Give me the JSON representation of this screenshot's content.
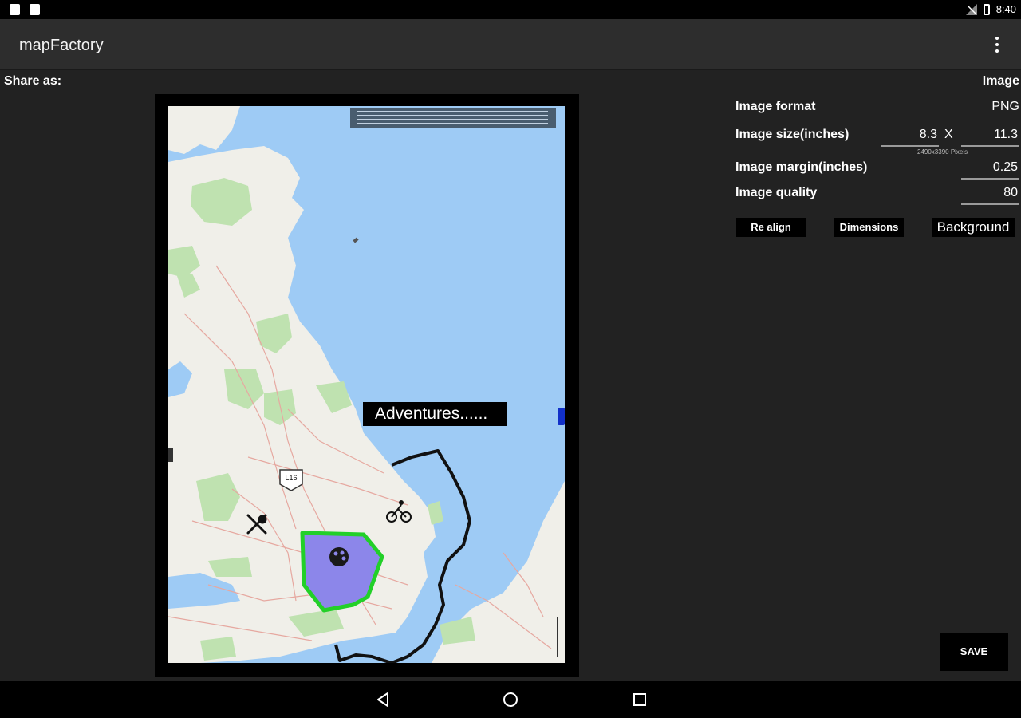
{
  "status_bar": {
    "time": "8:40"
  },
  "app_bar": {
    "title": "mapFactory"
  },
  "share": {
    "label": "Share as:",
    "type": "Image"
  },
  "map": {
    "label_text": "Adventures......",
    "road_shield": "L16"
  },
  "settings": {
    "format_label": "Image format",
    "format_value": "PNG",
    "size_label": "Image size(inches)",
    "size_width": "8.3",
    "size_x": "X",
    "size_height": "11.3",
    "size_pixels": "2490x3390 Pixels",
    "margin_label": "Image margin(inches)",
    "margin_value": "0.25",
    "quality_label": "Image quality",
    "quality_value": "80"
  },
  "buttons": {
    "realign": "Re align",
    "dimensions": "Dimensions",
    "background": "Background",
    "save": "SAVE"
  },
  "colors": {
    "sea": "#9ecbf5",
    "land": "#f0efe9",
    "polygon_fill": "#8c86ea",
    "polygon_border": "#22d028",
    "background": "#222222"
  }
}
